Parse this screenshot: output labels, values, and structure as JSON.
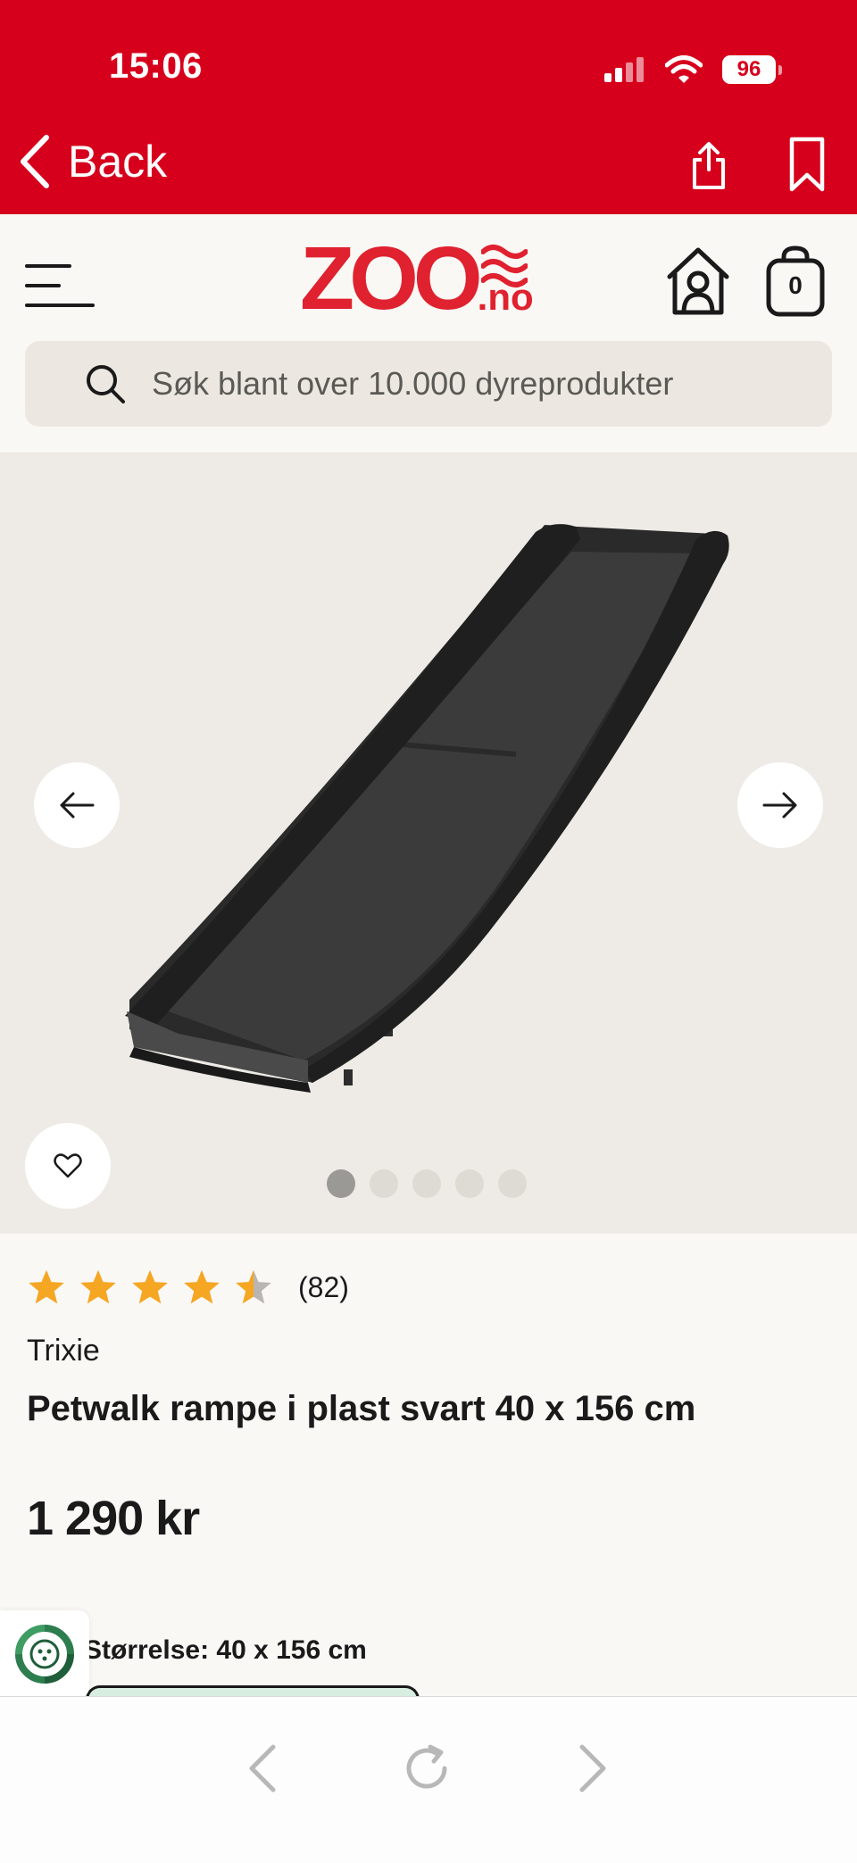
{
  "status_bar": {
    "time": "15:06",
    "battery": "96"
  },
  "nav": {
    "back_label": "Back"
  },
  "header": {
    "logo_main": "ZOO",
    "logo_suffix": "no",
    "cart_count": "0",
    "search_placeholder": "Søk blant over 10.000 dyreprodukter"
  },
  "gallery": {
    "image_count": 5,
    "active_index": 0
  },
  "product": {
    "rating": 4.5,
    "rating_max": 5,
    "review_count": "(82)",
    "brand": "Trixie",
    "title": "Petwalk rampe i plast svart 40 x 156 cm",
    "price": "1 290 kr",
    "size_label": "Størrelse: 40 x 156 cm"
  },
  "colors": {
    "brand_red": "#d6001c",
    "star": "#f5a623",
    "page_bg": "#faf8f5",
    "gallery_bg": "#eeebe6"
  },
  "icons": [
    "chevron-left-icon",
    "share-icon",
    "bookmark-icon",
    "menu-icon",
    "house-user-icon",
    "bag-icon",
    "search-icon",
    "arrow-left-icon",
    "arrow-right-icon",
    "heart-icon",
    "star-icon",
    "eco-icon",
    "reload-icon",
    "chevron-right-icon"
  ]
}
